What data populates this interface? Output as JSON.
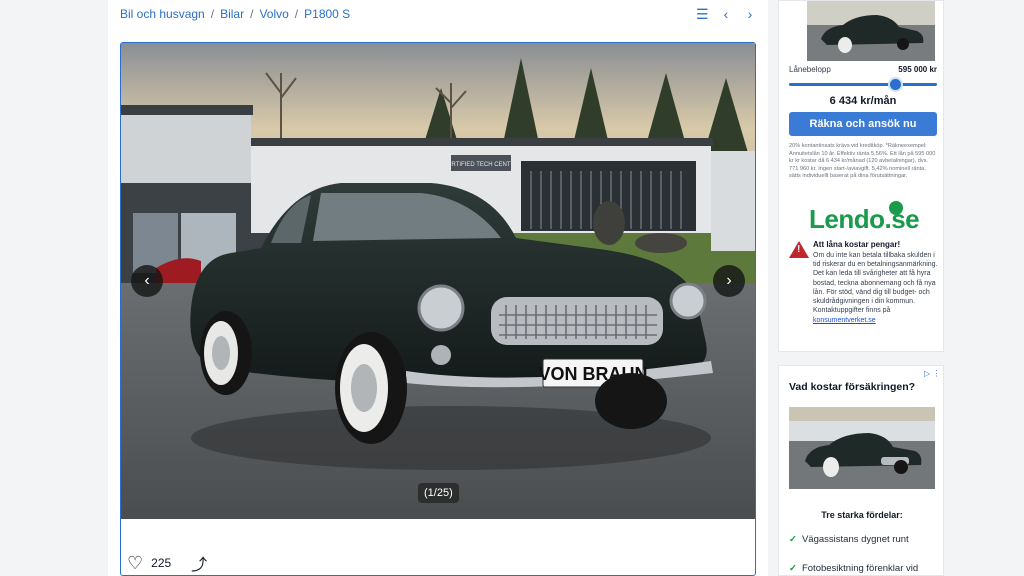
{
  "breadcrumb": [
    "Bil och husvagn",
    "Bilar",
    "Volvo",
    "P1800 S"
  ],
  "gallery": {
    "plate_text": "VON BRAUN",
    "building_sign": "CERTIFIED TECH CENTER",
    "counter": "(1/25)",
    "likes": "225"
  },
  "loan": {
    "label": "Lånebelopp",
    "amount": "595 000 kr",
    "monthly": "6 434 kr/mån",
    "button": "Räkna och ansök nu",
    "fineprint": "20% kontantinsats krävs vid kreditköp. *Räkneexempel: Annuitetslån 10 år. Effektiv ränta 5,56%. Ett lån på 595 000 kr kr kostar då 6 434 kr/månad (120 avbetalningar), dvs. 771 960 kr. Ingen start-/aviavgift. 5,42% nominell ränta, sätts individuellt baserat på dina förutsättningar.",
    "slider_fraction": 0.72
  },
  "lendo": {
    "logo": "Lendo.se",
    "warning_title": "Att låna kostar pengar!",
    "warning_text": "Om du inte kan betala tillbaka skulden i tid riskerar du en betalningsanmärkning. Det kan leda till svårigheter att få hyra bostad, teckna abonnemang och få nya lån. För stöd, vänd dig till budget- och skuldrådgivningen i din kommun. Kontaktuppgifter finns på ",
    "warning_link": "konsumentverket.se"
  },
  "insurance": {
    "title": "Vad kostar försäkringen?",
    "subtitle": "Tre starka fördelar:",
    "items": [
      "Vägassistans dygnet runt",
      "Fotobesiktning förenklar vid"
    ]
  },
  "colors": {
    "accent": "#2a6fc9",
    "lendo_green": "#1a9a4b",
    "warning_red": "#c0262d",
    "car_body": "#1e2a28"
  },
  "icons": {
    "list": "list-icon",
    "prev": "chevron-left-icon",
    "next": "chevron-right-icon",
    "heart": "heart-icon",
    "share": "share-icon"
  }
}
